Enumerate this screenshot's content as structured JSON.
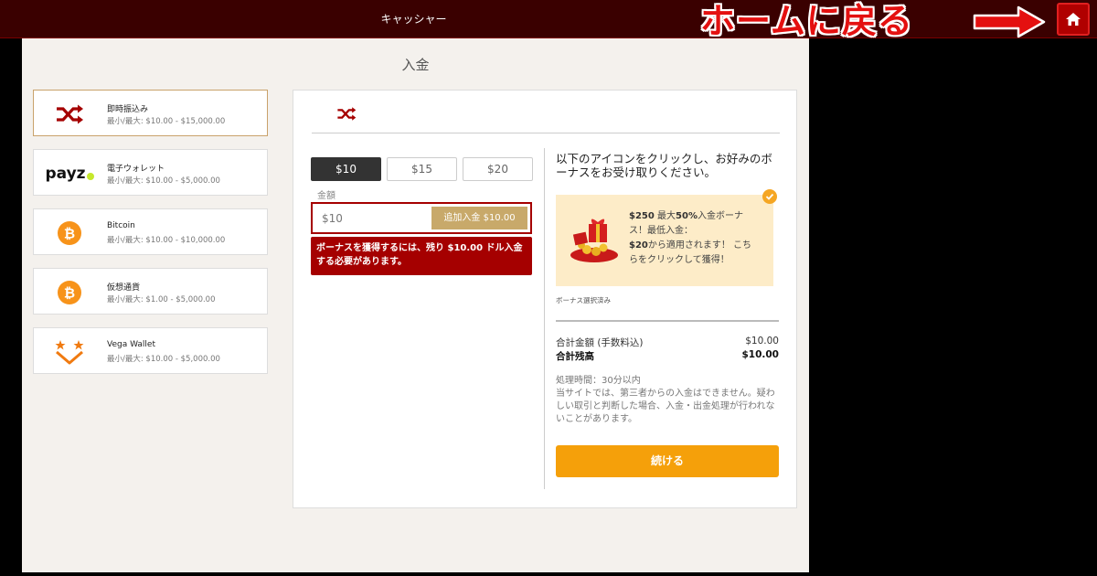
{
  "header": {
    "title": "キャッシャー",
    "annotation": "ホームに戻る",
    "home_icon": "home-icon"
  },
  "panel": {
    "title": "入金"
  },
  "methods": [
    {
      "name": "即時振込み",
      "range": "最小/最大: $10.00 - $15,000.00",
      "icon": "shuffle-icon",
      "active": true
    },
    {
      "name": "電子ウォレット",
      "range": "最小/最大: $10.00 - $5,000.00",
      "icon": "payz-logo",
      "logo_text": "payz"
    },
    {
      "name": "Bitcoin",
      "range": "最小/最大: $10.00 - $10,000.00",
      "icon": "bitcoin-icon"
    },
    {
      "name": "仮想通貨",
      "range": "最小/最大: $1.00 - $5,000.00",
      "icon": "bitcoin-icon"
    },
    {
      "name": "Vega Wallet",
      "range": "最小/最大: $10.00 - $5,000.00",
      "icon": "vega-wallet-icon"
    }
  ],
  "amounts": {
    "options": [
      "$10",
      "$15",
      "$20"
    ],
    "selected": "$10",
    "label": "金額",
    "input_value": "$10",
    "add_button": "追加入金 $10.00",
    "error": "ボーナスを獲得するには、残り $10.00 ドル入金する必要があります。"
  },
  "bonus": {
    "intro": "以下のアイコンをクリックし、お好みのボーナスをお受け取りください。",
    "line1_bold": "$250",
    "line1": " 最大",
    "line1_bold2": "50%",
    "line1_rest": "入金ボーナス！最低入金：",
    "line2_bold": "$20",
    "line2": "から適用されます！ こちらをクリックして獲得！",
    "selected_label": "ボーナス選択済み"
  },
  "summary": {
    "total_label": "合計金額 (手数料込)",
    "total_value": "$10.00",
    "balance_label": "合計残高",
    "balance_value": "$10.00"
  },
  "note": {
    "line1": "処理時間：30分以内",
    "line2": "当サイトでは、第三者からの入金はできません。疑わしい取引と判断した場合、入金・出金処理が行われないことがあります。"
  },
  "continue_button": "続ける",
  "colors": {
    "accent": "#a50000",
    "orange": "#f5a00a",
    "gold": "#c8a96a"
  }
}
